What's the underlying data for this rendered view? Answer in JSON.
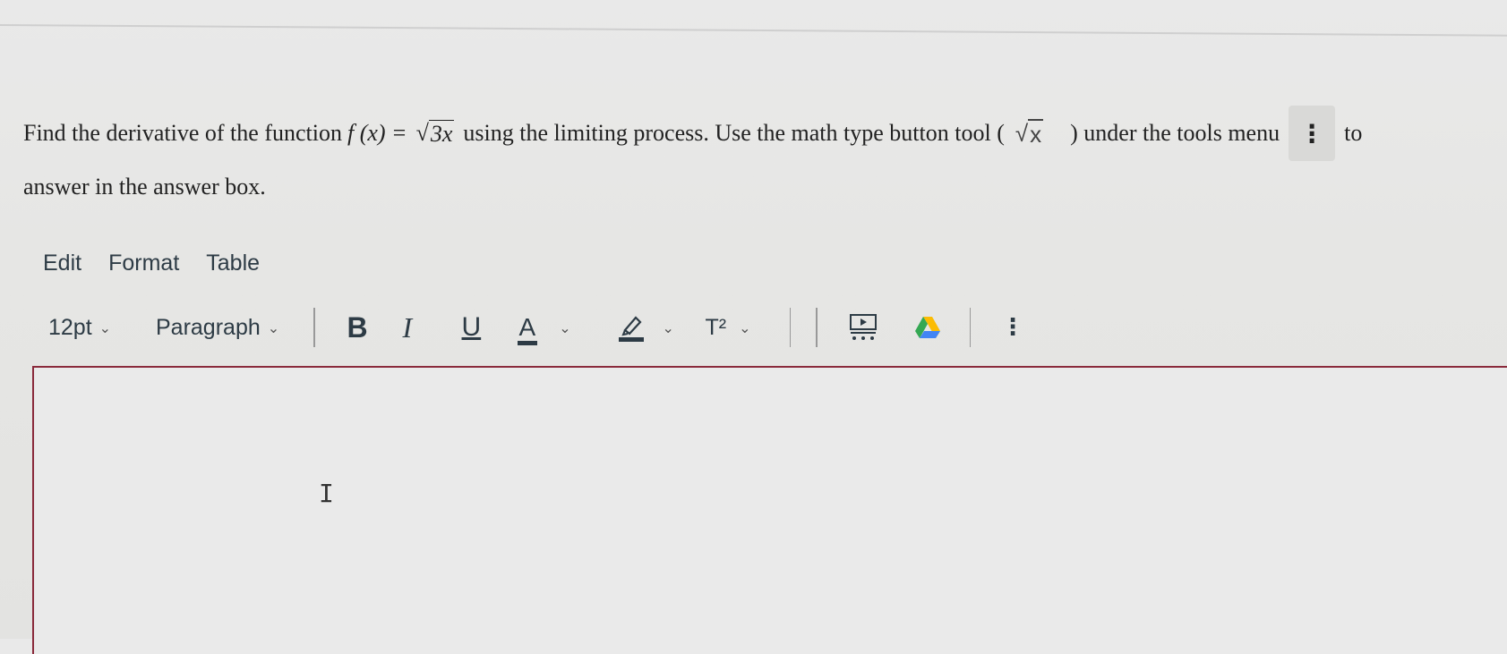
{
  "question": {
    "part1": "Find the derivative of the function",
    "func_lhs": "f (x) =",
    "func_radicand": "3x",
    "part2": "using the limiting process. Use the math type button tool (",
    "tool_label": "x",
    "part3": ") under the tools menu",
    "part4": "to",
    "line2": "answer in the answer box."
  },
  "menubar": {
    "edit": "Edit",
    "format": "Format",
    "table": "Table"
  },
  "toolbar": {
    "font_size": "12pt",
    "block_format": "Paragraph",
    "bold": "B",
    "italic": "I",
    "underline": "U",
    "text_color": "A",
    "superscript": "T²",
    "kebab": "⋮"
  },
  "icons": {
    "chevron": "chevron-down-icon",
    "highlighter": "highlighter-icon",
    "media": "media-embed-icon",
    "drive": "google-drive-icon",
    "more": "more-vertical-icon"
  },
  "colors": {
    "accent_border": "#8a2a3b",
    "text": "#2d3b45"
  }
}
